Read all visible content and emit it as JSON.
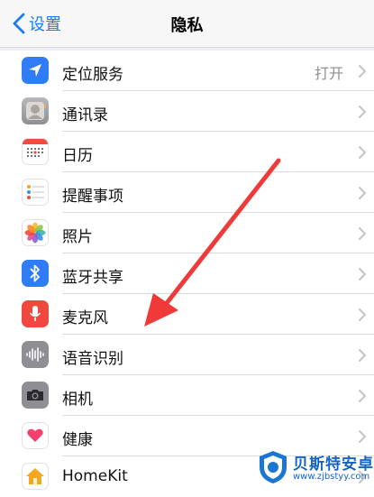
{
  "navbar": {
    "back_label": "设置",
    "title": "隐私"
  },
  "rows": [
    {
      "label": "定位服务",
      "value": "打开",
      "icon": "location-arrow-icon",
      "color": "#2f7cf6"
    },
    {
      "label": "通讯录",
      "icon": "contacts-icon",
      "color": "#9b9ba0"
    },
    {
      "label": "日历",
      "icon": "calendar-icon",
      "color": "#ffffff"
    },
    {
      "label": "提醒事项",
      "icon": "reminders-icon",
      "color": "#ffffff"
    },
    {
      "label": "照片",
      "icon": "photos-icon",
      "color": "#ffffff"
    },
    {
      "label": "蓝牙共享",
      "icon": "bluetooth-icon",
      "color": "#2f7cf6"
    },
    {
      "label": "麦克风",
      "icon": "microphone-icon",
      "color": "#f0483e"
    },
    {
      "label": "语音识别",
      "icon": "speech-recognition-icon",
      "color": "#8e8e93"
    },
    {
      "label": "相机",
      "icon": "camera-icon",
      "color": "#8e8e93"
    },
    {
      "label": "健康",
      "icon": "health-heart-icon",
      "color": "#ffffff"
    },
    {
      "label": "HomeKit",
      "icon": "homekit-house-icon",
      "color": "#ffffff"
    }
  ],
  "annotation": {
    "color": "#f03a3a"
  },
  "watermark": {
    "name": "贝斯特安卓网",
    "url": "www.zjbstyy.com"
  }
}
